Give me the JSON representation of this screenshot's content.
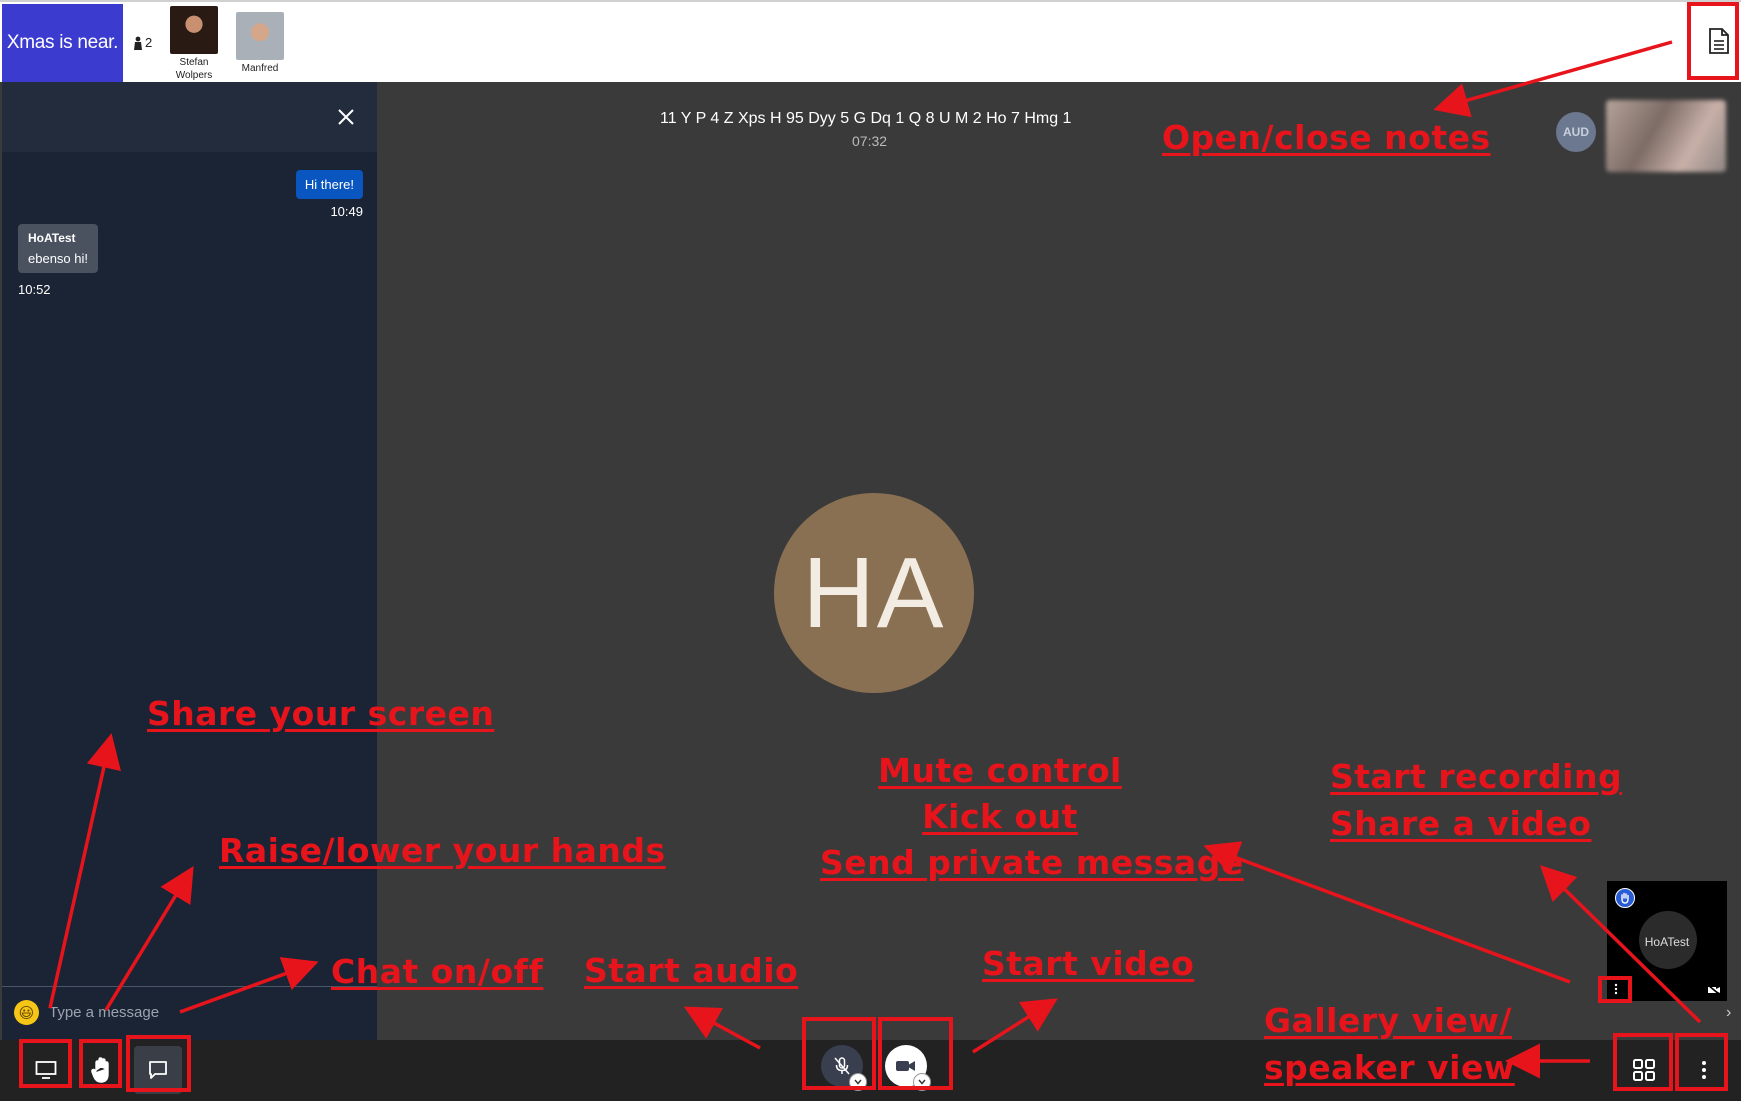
{
  "header": {
    "brand_text": "Xmas is near.",
    "visitor_count": "2",
    "participants": [
      {
        "name": "Stefan Wolpers"
      },
      {
        "name": "Manfred"
      }
    ]
  },
  "chat": {
    "messages": [
      {
        "text": "Hi there!",
        "time": "10:49",
        "own": true
      },
      {
        "sender": "HoATest",
        "text": "ebenso hi!",
        "time": "10:52",
        "own": false
      }
    ],
    "input_placeholder": "Type a message",
    "emoji": "😃"
  },
  "meeting": {
    "title": "11 Y P 4 Z Xps H 95 Dyy 5 G Dq 1 Q 8 U M 2 Ho 7 Hmg 1",
    "timer": "07:32",
    "speaker_initials": "HA",
    "audio_badge": "AUD",
    "self_tile_name": "HoATest",
    "strip_chevron": "›"
  },
  "annotations": {
    "notes": "Open/close notes",
    "share_screen": "Share your screen",
    "raise_hands": "Raise/lower your hands",
    "chat": "Chat on/off",
    "start_audio": "Start audio",
    "start_video": "Start video",
    "participant_menu": [
      "Mute control",
      "Kick out",
      "Send private message"
    ],
    "more_menu": [
      "Start recording",
      "Share a video"
    ],
    "view": [
      "Gallery view/",
      "speaker view"
    ]
  },
  "icons": {
    "notes": "document-icon",
    "close": "close-icon",
    "screen": "monitor-icon",
    "hand": "hand-icon",
    "chat": "chat-bubble-icon",
    "mic": "microphone-muted-icon",
    "camera": "video-camera-icon",
    "gallery": "grid-icon",
    "more": "vertical-dots-icon"
  },
  "colors": {
    "brand": "#3b3bd0",
    "annotation": "#e8141c",
    "chat_panel": "#1b2434",
    "stage": "#3a3a3a",
    "own_message": "#0a56c0",
    "speaker_avatar": "#8a7052"
  }
}
